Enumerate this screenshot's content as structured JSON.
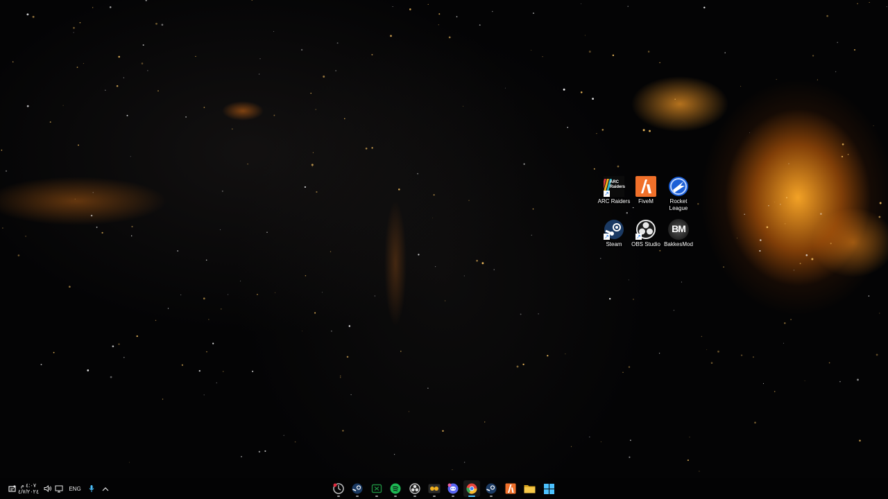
{
  "desktop": {
    "icons": [
      {
        "label": "ARC Raiders",
        "icon": "arc-raiders-logo",
        "shortcut": true,
        "logo_text": "ARC Raiders"
      },
      {
        "label": "FiveM",
        "icon": "fivem-logo",
        "shortcut": false
      },
      {
        "label": "Rocket League",
        "icon": "rocket-league-logo",
        "shortcut": false
      },
      {
        "label": "Steam",
        "icon": "steam-logo",
        "shortcut": true
      },
      {
        "label": "OBS Studio",
        "icon": "obs-logo",
        "shortcut": true
      },
      {
        "label": "BakkesMod",
        "icon": "bakkesmod-logo",
        "shortcut": false,
        "logo_text": "BM"
      }
    ]
  },
  "taskbar": {
    "tray": {
      "clock_time": "٤:٠٧ م",
      "clock_date": "٤/٧/٢٠٢٤",
      "language": "ENG"
    },
    "apps": [
      {
        "name": "recorder-app-icon",
        "active": false,
        "running": true
      },
      {
        "name": "steam-app-icon",
        "active": false,
        "running": true
      },
      {
        "name": "xbox-app-icon",
        "active": false,
        "running": true
      },
      {
        "name": "spotify-app-icon",
        "active": false,
        "running": true
      },
      {
        "name": "obs-app-icon",
        "active": false,
        "running": true
      },
      {
        "name": "bakkesmod-app-icon",
        "active": false,
        "running": true
      },
      {
        "name": "discord-app-icon",
        "active": false,
        "running": true
      },
      {
        "name": "chrome-app-icon",
        "active": true,
        "running": true
      },
      {
        "name": "steam-app-icon-2",
        "active": false,
        "running": true
      },
      {
        "name": "fivem-app-icon",
        "active": false,
        "running": false
      },
      {
        "name": "file-explorer-icon",
        "active": false,
        "running": false
      },
      {
        "name": "windows-start-icon",
        "active": false,
        "running": false
      }
    ]
  },
  "colors": {
    "accent": "#4cc2ff",
    "nebula": "#f5a020",
    "fivem": "#f0702a",
    "spotify": "#1db954",
    "discord": "#5865f2",
    "folder": "#f7c948"
  }
}
